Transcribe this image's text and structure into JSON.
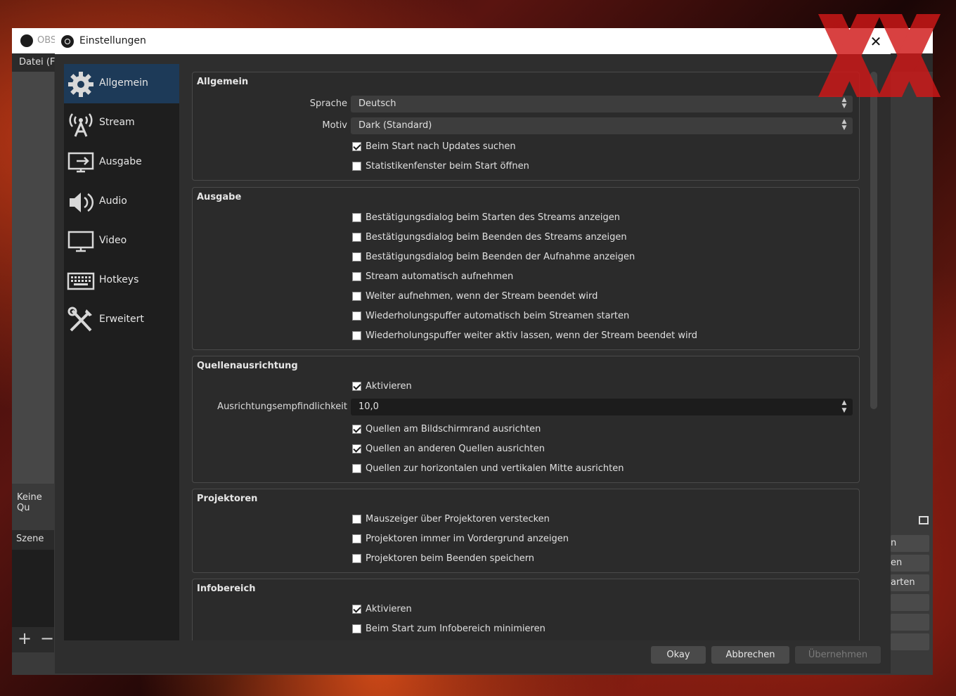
{
  "main_window": {
    "title": "OBS",
    "menu_partial": "Datei (F",
    "no_source": "Keine Qu",
    "scene_header": "Szene",
    "scene_add": "+",
    "scene_remove": "−",
    "right_buttons": [
      "n",
      "en",
      "arten",
      "",
      "",
      ""
    ]
  },
  "dialog": {
    "title": "Einstellungen",
    "close": "✕"
  },
  "sidebar": {
    "items": [
      {
        "label": "Allgemein",
        "icon": "gear-icon",
        "active": true
      },
      {
        "label": "Stream",
        "icon": "antenna-icon"
      },
      {
        "label": "Ausgabe",
        "icon": "output-icon"
      },
      {
        "label": "Audio",
        "icon": "speaker-icon"
      },
      {
        "label": "Video",
        "icon": "monitor-icon"
      },
      {
        "label": "Hotkeys",
        "icon": "keyboard-icon"
      },
      {
        "label": "Erweitert",
        "icon": "tools-icon"
      }
    ]
  },
  "groups": {
    "allgemein": {
      "title": "Allgemein",
      "sprache_label": "Sprache",
      "sprache_value": "Deutsch",
      "motiv_label": "Motiv",
      "motiv_value": "Dark (Standard)",
      "checks": [
        {
          "label": "Beim Start nach Updates suchen",
          "checked": true
        },
        {
          "label": "Statistikenfenster beim Start öffnen",
          "checked": false
        }
      ]
    },
    "ausgabe": {
      "title": "Ausgabe",
      "checks": [
        {
          "label": "Bestätigungsdialog beim Starten des Streams anzeigen",
          "checked": false
        },
        {
          "label": "Bestätigungsdialog beim Beenden des Streams anzeigen",
          "checked": false
        },
        {
          "label": "Bestätigungsdialog beim Beenden der Aufnahme anzeigen",
          "checked": false
        },
        {
          "label": "Stream automatisch aufnehmen",
          "checked": false
        },
        {
          "label": "Weiter aufnehmen, wenn der Stream beendet wird",
          "checked": false
        },
        {
          "label": "Wiederholungspuffer automatisch beim Streamen starten",
          "checked": false
        },
        {
          "label": "Wiederholungspuffer weiter aktiv lassen, wenn der Stream beendet wird",
          "checked": false
        }
      ]
    },
    "quellen": {
      "title": "Quellenausrichtung",
      "aktivieren": "Aktivieren",
      "sens_label": "Ausrichtungsempfindlichkeit",
      "sens_value": "10,0",
      "checks": [
        {
          "label": "Quellen am Bildschirmrand ausrichten",
          "checked": true
        },
        {
          "label": "Quellen an anderen Quellen ausrichten",
          "checked": true
        },
        {
          "label": "Quellen zur horizontalen und vertikalen Mitte ausrichten",
          "checked": false
        }
      ]
    },
    "projektoren": {
      "title": "Projektoren",
      "checks": [
        {
          "label": "Mauszeiger über Projektoren verstecken",
          "checked": false
        },
        {
          "label": "Projektoren immer im Vordergrund anzeigen",
          "checked": false
        },
        {
          "label": "Projektoren beim Beenden speichern",
          "checked": false
        }
      ]
    },
    "infobereich": {
      "title": "Infobereich",
      "checks": [
        {
          "label": "Aktivieren",
          "checked": true
        },
        {
          "label": "Beim Start zum Infobereich minimieren",
          "checked": false
        }
      ]
    }
  },
  "buttons": {
    "okay": "Okay",
    "abbrechen": "Abbrechen",
    "uebernehmen": "Übernehmen"
  },
  "colors": {
    "active_nav": "#1d3a58",
    "dialog_bg": "#2e2e2e",
    "watermark": "#d01818"
  }
}
